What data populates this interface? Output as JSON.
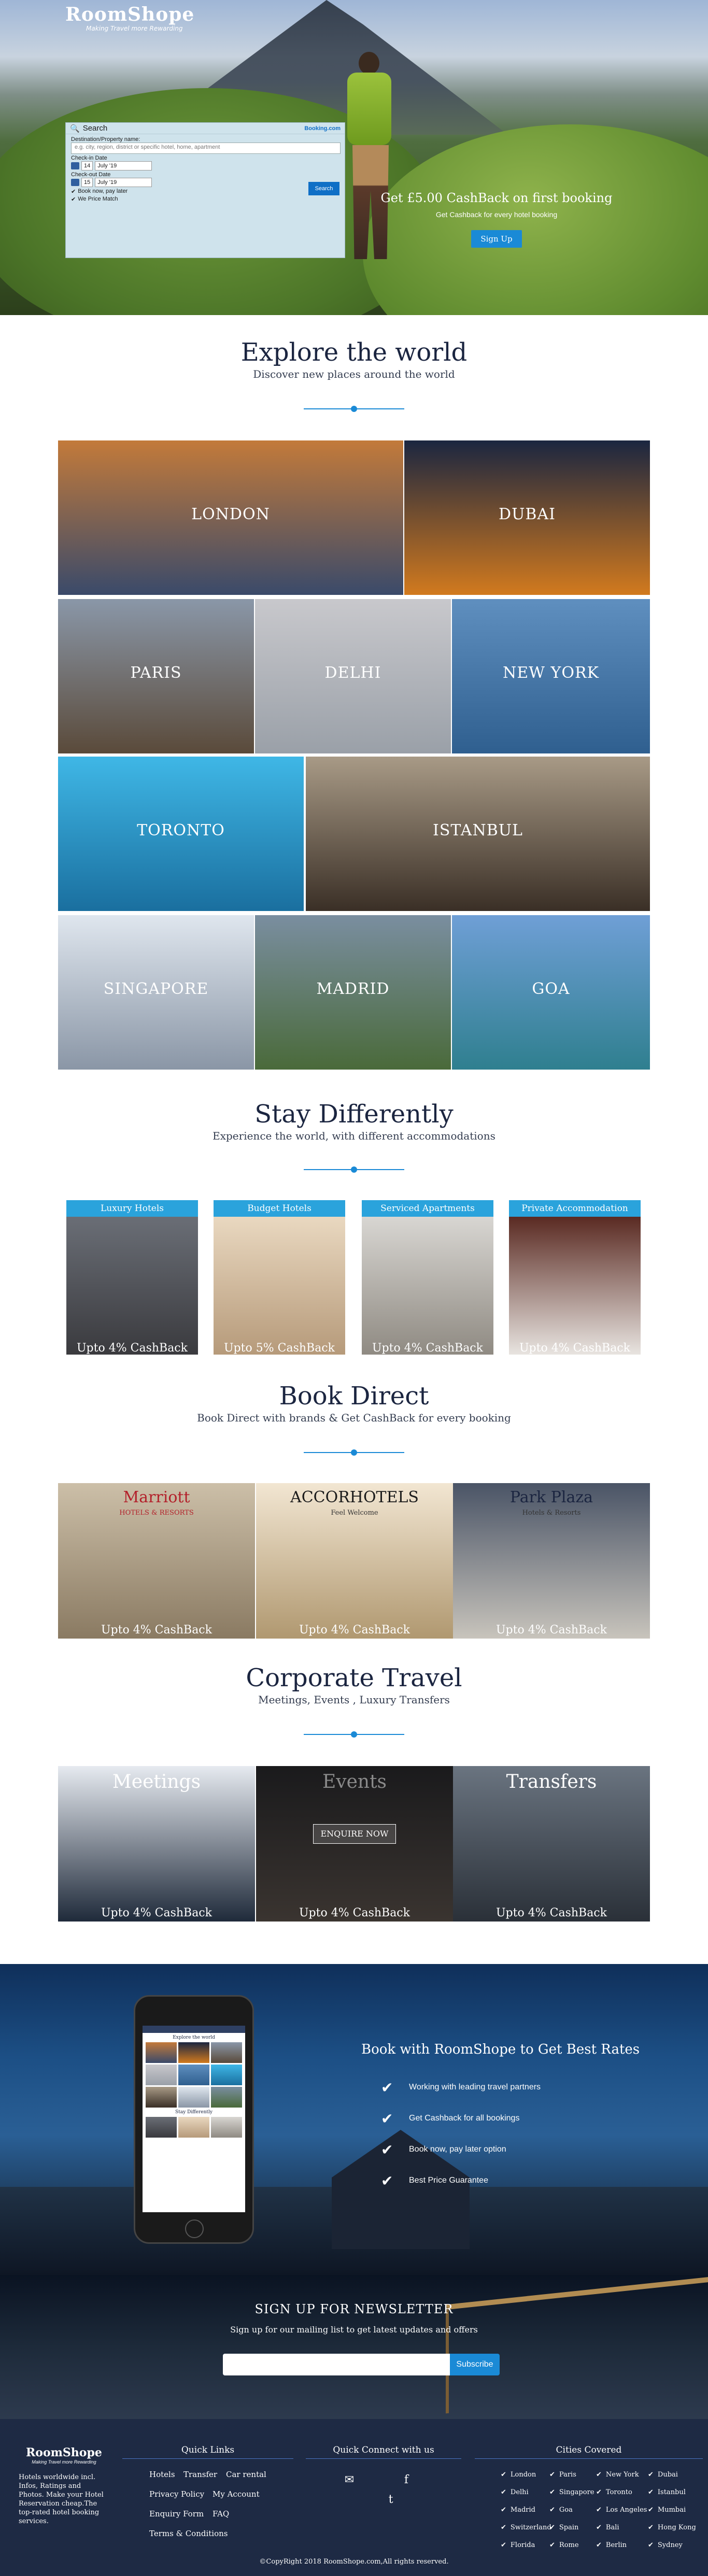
{
  "brand": {
    "name": "RoomShope",
    "tagline": "Making Travel more Rewarding"
  },
  "search": {
    "title": "Search",
    "partner": "Booking.com",
    "dest_label": "Destination/Property name:",
    "dest_placeholder": "e.g. city, region, district or specific hotel, home, apartment",
    "checkin_label": "Check-in Date",
    "checkin_day": "14",
    "checkin_month": "July '19",
    "checkout_label": "Check-out Date",
    "checkout_day": "15",
    "checkout_month": "July '19",
    "opt1": "Book now, pay later",
    "opt2": "We Price Match",
    "button": "Search"
  },
  "hero": {
    "headline": "Get £5.00 CashBack on first booking",
    "sub": "Get Cashback for every hotel booking",
    "cta": "Sign Up"
  },
  "explore": {
    "title": "Explore the world",
    "subtitle": "Discover new places around the world",
    "cities": [
      {
        "name": "LONDON",
        "color1": "#c37a3a",
        "color2": "#3a4a6a"
      },
      {
        "name": "DUBAI",
        "color1": "#1b2640",
        "color2": "#d27a1e"
      },
      {
        "name": "PARIS",
        "color1": "#8a97a8",
        "color2": "#5a4a3a"
      },
      {
        "name": "DELHI",
        "color1": "#c8c8cc",
        "color2": "#9aa0a8"
      },
      {
        "name": "NEW YORK",
        "color1": "#5f8fbf",
        "color2": "#2f5f8f"
      },
      {
        "name": "TORONTO",
        "color1": "#3fb7e6",
        "color2": "#1a6f9f"
      },
      {
        "name": "ISTANBUL",
        "color1": "#a89a86",
        "color2": "#3a2f26"
      },
      {
        "name": "SINGAPORE",
        "color1": "#dfe6ee",
        "color2": "#8a96a6"
      },
      {
        "name": "MADRID",
        "color1": "#7a8ea0",
        "color2": "#4a6a3a"
      },
      {
        "name": "GOA",
        "color1": "#6f9fd6",
        "color2": "#2f7f8f"
      }
    ]
  },
  "stay": {
    "title": "Stay Differently",
    "subtitle": "Experience the world, with different accommodations",
    "types": [
      {
        "label": "Luxury Hotels",
        "cashback": "Upto 4% CashBack",
        "color1": "#6a6e76",
        "color2": "#3a3a3e"
      },
      {
        "label": "Budget Hotels",
        "cashback": "Upto 5% CashBack",
        "color1": "#e9d8c0",
        "color2": "#b69a7a"
      },
      {
        "label": "Serviced Apartments",
        "cashback": "Upto 4% CashBack",
        "color1": "#d8d6d2",
        "color2": "#8f8a82"
      },
      {
        "label": "Private Accommodation",
        "cashback": "Upto 4% CashBack",
        "color1": "#5a2a22",
        "color2": "#e8e4e0"
      }
    ]
  },
  "direct": {
    "title": "Book Direct",
    "subtitle": "Book Direct with brands & Get CashBack for every booking",
    "brands": [
      {
        "logo": "Marriott",
        "logo2": "HOTELS & RESORTS",
        "cashback": "Upto 4% CashBack",
        "color1": "#ccbfa8",
        "color2": "#8a7a62"
      },
      {
        "logo": "ACCORHOTELS",
        "logo2": "Feel Welcome",
        "cashback": "Upto 4% CashBack",
        "color1": "#f2e6d2",
        "color2": "#b09870"
      },
      {
        "logo": "Park Plaza",
        "logo2": "Hotels & Resorts",
        "cashback": "Upto 4% CashBack",
        "color1": "#4a5466",
        "color2": "#c8c4bc"
      }
    ]
  },
  "corporate": {
    "title": "Corporate Travel",
    "subtitle": "Meetings, Events , Luxury Transfers",
    "items": [
      {
        "label": "Meetings",
        "cashback": "Upto 4% CashBack",
        "color1": "#e6eaf0",
        "color2": "#1f2a3a"
      },
      {
        "label": "Events",
        "cashback": "Upto 4% CashBack",
        "color1": "#1a1a1c",
        "color2": "#3a3430"
      },
      {
        "label": "Transfers",
        "cashback": "Upto 4% CashBack",
        "color1": "#6a7480",
        "color2": "#2a3038"
      }
    ],
    "enquire": "ENQUIRE NOW"
  },
  "promo": {
    "headline": "Book with RoomShope to Get Best Rates",
    "points": [
      "Working with leading travel partners",
      "Get Cashback for all bookings",
      "Book now, pay later option",
      "Best Price Guarantee"
    ],
    "phone_caption1": "Explore the world",
    "phone_caption2": "Stay Differently"
  },
  "newsletter": {
    "title": "SIGN UP FOR NEWSLETTER",
    "subtitle": "Sign up for our mailing list to get latest updates and offers",
    "button": "Subscribe"
  },
  "footer": {
    "about": "Hotels worldwide incl. Infos, Ratings and Photos. Make your Hotel Reservation cheap.The top-rated hotel booking services.",
    "quick_title": "Quick Links",
    "links": [
      "Hotels",
      "Transfer",
      "Car rental",
      "Privacy Policy",
      "My Account",
      "Enquiry Form",
      "FAQ",
      "Terms & Conditions"
    ],
    "connect_title": "Quick Connect with us",
    "cities_title": "Cities Covered",
    "cities": [
      "London",
      "Paris",
      "New York",
      "Dubai",
      "Delhi",
      "Singapore",
      "Toronto",
      "Istanbul",
      "Madrid",
      "Goa",
      "Los Angeles",
      "Mumbai",
      "Switzerland",
      "Spain",
      "Bali",
      "Hong Kong",
      "Florida",
      "Rome",
      "Berlin",
      "Sydney"
    ],
    "copyright": "©CopyRight 2018 RoomShope.com,All rights reserved."
  }
}
